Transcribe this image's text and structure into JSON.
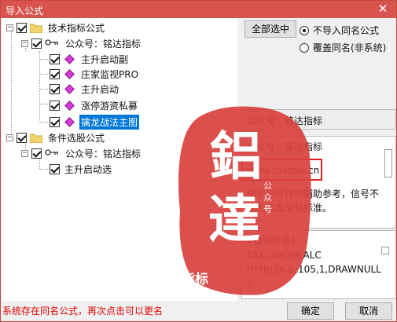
{
  "window": {
    "title": "导入公式",
    "close_glyph": "✕"
  },
  "tree": {
    "group1": {
      "label": "技术指标公式",
      "publisher": "公众号：铭达指标",
      "items": [
        "主升启动副",
        "庄家监视PRO",
        "主升启动",
        "涨停游资私募",
        "擒龙战法主图"
      ],
      "selected_index": 4
    },
    "group2": {
      "label": "条件选股公式",
      "publisher": "公众号：铭达指标",
      "items": [
        "主升启动选"
      ]
    },
    "expander_minus": "−"
  },
  "options": {
    "select_all_label": "全部选中",
    "radio1": "不导入同名公式",
    "radio2": "覆盖同名(非系统)",
    "selected": "radio1"
  },
  "info": {
    "line": "公众号：铭达指标"
  },
  "description": {
    "line1": "公众号：铭达指标",
    "line2": "www.tdxgsw.cn",
    "line3": "指标只可作为辅助参考，信号不",
    "line4": "作为实盘交易标准。"
  },
  "code": {
    "line1": "{板块排名}",
    "line2": "TAX:=HORCALC",
    "line3": "(HYBLOCK,105,1,DRAWNULL",
    "line4": ");"
  },
  "watermark": {
    "big1": "鋁",
    "big2": "達",
    "small": "公众号",
    "bottom": "指标"
  },
  "status": {
    "text": "系统存在同名公式，再次点击可以更名"
  },
  "buttons": {
    "ok": "确定",
    "cancel": "取消"
  },
  "colors": {
    "title_bar": "#d9534f",
    "stamp": "#d8433f",
    "selection": "#0078d7",
    "status_text": "#e00000"
  },
  "icons": [
    "folder-icon",
    "key-icon",
    "diamond-icon",
    "close-icon"
  ]
}
